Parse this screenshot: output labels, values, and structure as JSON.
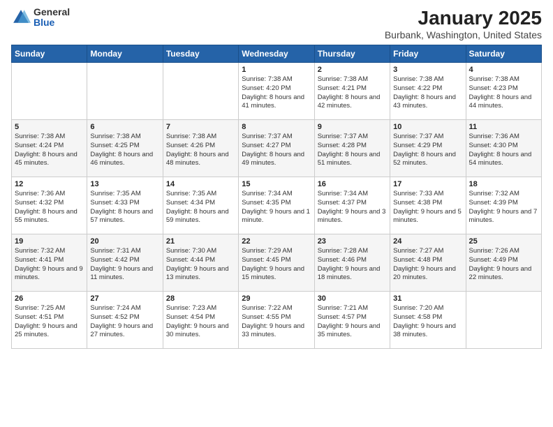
{
  "header": {
    "logo_general": "General",
    "logo_blue": "Blue",
    "title": "January 2025",
    "subtitle": "Burbank, Washington, United States"
  },
  "days_of_week": [
    "Sunday",
    "Monday",
    "Tuesday",
    "Wednesday",
    "Thursday",
    "Friday",
    "Saturday"
  ],
  "weeks": [
    [
      {
        "day": "",
        "info": ""
      },
      {
        "day": "",
        "info": ""
      },
      {
        "day": "",
        "info": ""
      },
      {
        "day": "1",
        "info": "Sunrise: 7:38 AM\nSunset: 4:20 PM\nDaylight: 8 hours and 41 minutes."
      },
      {
        "day": "2",
        "info": "Sunrise: 7:38 AM\nSunset: 4:21 PM\nDaylight: 8 hours and 42 minutes."
      },
      {
        "day": "3",
        "info": "Sunrise: 7:38 AM\nSunset: 4:22 PM\nDaylight: 8 hours and 43 minutes."
      },
      {
        "day": "4",
        "info": "Sunrise: 7:38 AM\nSunset: 4:23 PM\nDaylight: 8 hours and 44 minutes."
      }
    ],
    [
      {
        "day": "5",
        "info": "Sunrise: 7:38 AM\nSunset: 4:24 PM\nDaylight: 8 hours and 45 minutes."
      },
      {
        "day": "6",
        "info": "Sunrise: 7:38 AM\nSunset: 4:25 PM\nDaylight: 8 hours and 46 minutes."
      },
      {
        "day": "7",
        "info": "Sunrise: 7:38 AM\nSunset: 4:26 PM\nDaylight: 8 hours and 48 minutes."
      },
      {
        "day": "8",
        "info": "Sunrise: 7:37 AM\nSunset: 4:27 PM\nDaylight: 8 hours and 49 minutes."
      },
      {
        "day": "9",
        "info": "Sunrise: 7:37 AM\nSunset: 4:28 PM\nDaylight: 8 hours and 51 minutes."
      },
      {
        "day": "10",
        "info": "Sunrise: 7:37 AM\nSunset: 4:29 PM\nDaylight: 8 hours and 52 minutes."
      },
      {
        "day": "11",
        "info": "Sunrise: 7:36 AM\nSunset: 4:30 PM\nDaylight: 8 hours and 54 minutes."
      }
    ],
    [
      {
        "day": "12",
        "info": "Sunrise: 7:36 AM\nSunset: 4:32 PM\nDaylight: 8 hours and 55 minutes."
      },
      {
        "day": "13",
        "info": "Sunrise: 7:35 AM\nSunset: 4:33 PM\nDaylight: 8 hours and 57 minutes."
      },
      {
        "day": "14",
        "info": "Sunrise: 7:35 AM\nSunset: 4:34 PM\nDaylight: 8 hours and 59 minutes."
      },
      {
        "day": "15",
        "info": "Sunrise: 7:34 AM\nSunset: 4:35 PM\nDaylight: 9 hours and 1 minute."
      },
      {
        "day": "16",
        "info": "Sunrise: 7:34 AM\nSunset: 4:37 PM\nDaylight: 9 hours and 3 minutes."
      },
      {
        "day": "17",
        "info": "Sunrise: 7:33 AM\nSunset: 4:38 PM\nDaylight: 9 hours and 5 minutes."
      },
      {
        "day": "18",
        "info": "Sunrise: 7:32 AM\nSunset: 4:39 PM\nDaylight: 9 hours and 7 minutes."
      }
    ],
    [
      {
        "day": "19",
        "info": "Sunrise: 7:32 AM\nSunset: 4:41 PM\nDaylight: 9 hours and 9 minutes."
      },
      {
        "day": "20",
        "info": "Sunrise: 7:31 AM\nSunset: 4:42 PM\nDaylight: 9 hours and 11 minutes."
      },
      {
        "day": "21",
        "info": "Sunrise: 7:30 AM\nSunset: 4:44 PM\nDaylight: 9 hours and 13 minutes."
      },
      {
        "day": "22",
        "info": "Sunrise: 7:29 AM\nSunset: 4:45 PM\nDaylight: 9 hours and 15 minutes."
      },
      {
        "day": "23",
        "info": "Sunrise: 7:28 AM\nSunset: 4:46 PM\nDaylight: 9 hours and 18 minutes."
      },
      {
        "day": "24",
        "info": "Sunrise: 7:27 AM\nSunset: 4:48 PM\nDaylight: 9 hours and 20 minutes."
      },
      {
        "day": "25",
        "info": "Sunrise: 7:26 AM\nSunset: 4:49 PM\nDaylight: 9 hours and 22 minutes."
      }
    ],
    [
      {
        "day": "26",
        "info": "Sunrise: 7:25 AM\nSunset: 4:51 PM\nDaylight: 9 hours and 25 minutes."
      },
      {
        "day": "27",
        "info": "Sunrise: 7:24 AM\nSunset: 4:52 PM\nDaylight: 9 hours and 27 minutes."
      },
      {
        "day": "28",
        "info": "Sunrise: 7:23 AM\nSunset: 4:54 PM\nDaylight: 9 hours and 30 minutes."
      },
      {
        "day": "29",
        "info": "Sunrise: 7:22 AM\nSunset: 4:55 PM\nDaylight: 9 hours and 33 minutes."
      },
      {
        "day": "30",
        "info": "Sunrise: 7:21 AM\nSunset: 4:57 PM\nDaylight: 9 hours and 35 minutes."
      },
      {
        "day": "31",
        "info": "Sunrise: 7:20 AM\nSunset: 4:58 PM\nDaylight: 9 hours and 38 minutes."
      },
      {
        "day": "",
        "info": ""
      }
    ]
  ]
}
